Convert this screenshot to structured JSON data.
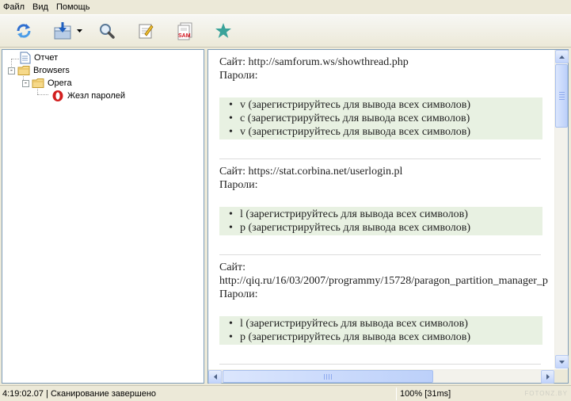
{
  "menu": {
    "items": [
      "Файл",
      "Вид",
      "Помощь"
    ]
  },
  "toolbar": {
    "icons": [
      "refresh-icon",
      "save-icon",
      "search-icon",
      "edit-icon",
      "sam-report-icon",
      "favorite-star-icon"
    ],
    "sam_label": "SAM"
  },
  "tree": {
    "items": [
      {
        "label": "Отчет",
        "icon": "document-icon"
      },
      {
        "label": "Browsers",
        "icon": "folder-icon",
        "expander": "-"
      },
      {
        "label": "Opera",
        "icon": "folder-icon",
        "expander": "-"
      },
      {
        "label": "Жезл паролей",
        "icon": "opera-icon"
      }
    ]
  },
  "report": {
    "entries": [
      {
        "site_lines": [
          "Сайт: http://samforum.ws/showthread.php"
        ],
        "passwords_label": "Пароли:",
        "passwords": [
          "v (зарегистрируйтесь для вывода всех символов)",
          "c (зарегистрируйтесь для вывода всех символов)",
          "v (зарегистрируйтесь для вывода всех символов)"
        ]
      },
      {
        "site_lines": [
          "Сайт: https://stat.corbina.net/userlogin.pl"
        ],
        "passwords_label": "Пароли:",
        "passwords": [
          "l (зарегистрируйтесь для вывода всех символов)",
          "p (зарегистрируйтесь для вывода всех символов)"
        ]
      },
      {
        "site_lines": [
          "Сайт:",
          "http://qiq.ru/16/03/2007/programmy/15728/paragon_partition_manager_p"
        ],
        "passwords_label": "Пароли:",
        "passwords": [
          "l (зарегистрируйтесь для вывода всех символов)",
          "p (зарегистрируйтесь для вывода всех символов)"
        ]
      }
    ]
  },
  "status": {
    "left": "4:19:02.07 | Сканирование завершено",
    "right": "100% [31ms]",
    "watermark": "FOTONZ.BY"
  },
  "colors": {
    "password_highlight": "#e8f1e2",
    "panel_border": "#7f9db9",
    "window_bg": "#ece9d8",
    "star": "#3aa39a"
  }
}
